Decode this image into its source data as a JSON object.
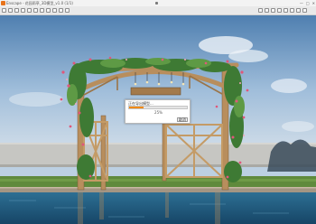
{
  "window": {
    "title": "Enscape - 花园雨亭_3D模型_v1.0 (1/1)",
    "controls": {
      "minimize": "—",
      "maximize": "□",
      "close": "✕"
    }
  },
  "toolbar": {
    "left_tools": [
      "capture-icon",
      "video-icon",
      "panorama-icon",
      "batch-icon",
      "asset-library-icon",
      "sync-icon",
      "view-icon",
      "camera-icon",
      "light-icon",
      "settings-icon",
      "visual-settings-icon"
    ],
    "right_tools": [
      "render-mode-icon",
      "capture-settings-icon",
      "views-icon",
      "help-icon",
      "feedback-icon",
      "account-icon",
      "more-icon",
      "share-icon"
    ]
  },
  "dialog": {
    "title": "正在导出模型...",
    "progress": 0.25,
    "progress_text": "25%",
    "cancel_label": "取消",
    "colors": {
      "fill": "#f08a12",
      "track": "#e4e4e4"
    }
  }
}
